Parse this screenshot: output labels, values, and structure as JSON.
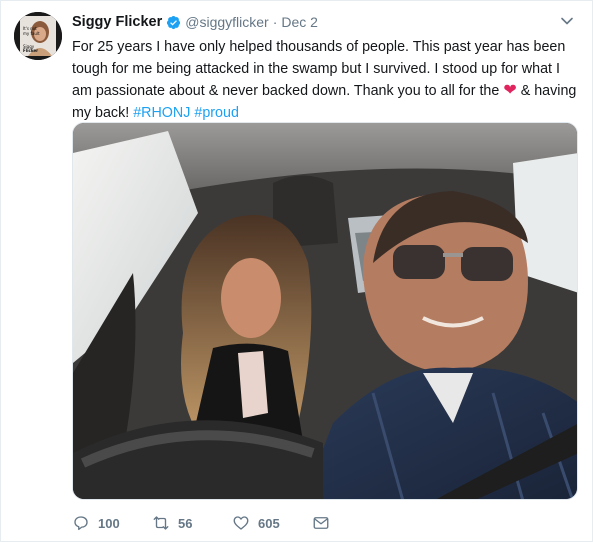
{
  "tweet": {
    "author_name": "Siggy Flicker",
    "author_handle": "@siggyflicker",
    "separator": "·",
    "date": "Dec 2",
    "text_lines": [
      "For 25 years I have only helped thousands of people. This past year has been",
      "tough for me being attacked in the swamp but I survived. I stood up for what I",
      "am passionate about & never backed down. Thank you to all for the"
    ],
    "text_after_heart": "& having",
    "text_last_line": "my back!",
    "hashtags": [
      "#RHONJ",
      "#proud"
    ],
    "avatar_text": [
      "It's not",
      "my fault",
      "Siggy",
      "Flicker"
    ]
  },
  "actions": {
    "replies": "100",
    "retweets": "56",
    "likes": "605"
  },
  "icons": {
    "verified": "verified-badge-icon",
    "caret": "chevron-down-icon",
    "reply": "reply-icon",
    "retweet": "retweet-icon",
    "like": "heart-icon",
    "dm": "envelope-icon"
  },
  "colors": {
    "link": "#1da1f2",
    "heart": "#e0245e",
    "muted": "#657786"
  }
}
